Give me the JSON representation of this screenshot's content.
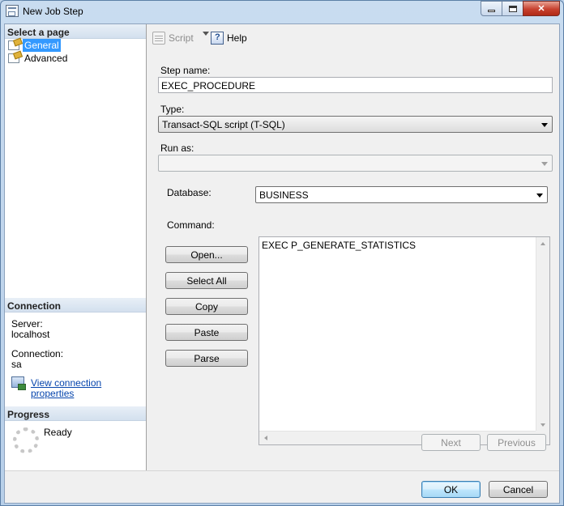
{
  "window": {
    "title": "New Job Step"
  },
  "left_pane": {
    "select_page_header": "Select a page",
    "pages": [
      {
        "label": "General",
        "selected": true
      },
      {
        "label": "Advanced",
        "selected": false
      }
    ],
    "connection": {
      "header": "Connection",
      "server_label": "Server:",
      "server_value": "localhost",
      "connection_label": "Connection:",
      "connection_value": "sa",
      "view_properties_link": "View connection properties"
    },
    "progress": {
      "header": "Progress",
      "status": "Ready"
    }
  },
  "toolbar": {
    "script_label": "Script",
    "help_label": "Help"
  },
  "form": {
    "step_name_label": "Step name:",
    "step_name_value": "EXEC_PROCEDURE",
    "type_label": "Type:",
    "type_value": "Transact-SQL script (T-SQL)",
    "run_as_label": "Run as:",
    "run_as_value": "",
    "database_label": "Database:",
    "database_value": "BUSINESS",
    "command_label": "Command:",
    "command_value": "EXEC P_GENERATE_STATISTICS",
    "buttons": {
      "open": "Open...",
      "select_all": "Select All",
      "copy": "Copy",
      "paste": "Paste",
      "parse": "Parse"
    },
    "next_label": "Next",
    "previous_label": "Previous"
  },
  "footer": {
    "ok_label": "OK",
    "cancel_label": "Cancel"
  },
  "colors": {
    "selection": "#3399ff",
    "link": "#0645ad",
    "close_button": "#c7412f"
  }
}
